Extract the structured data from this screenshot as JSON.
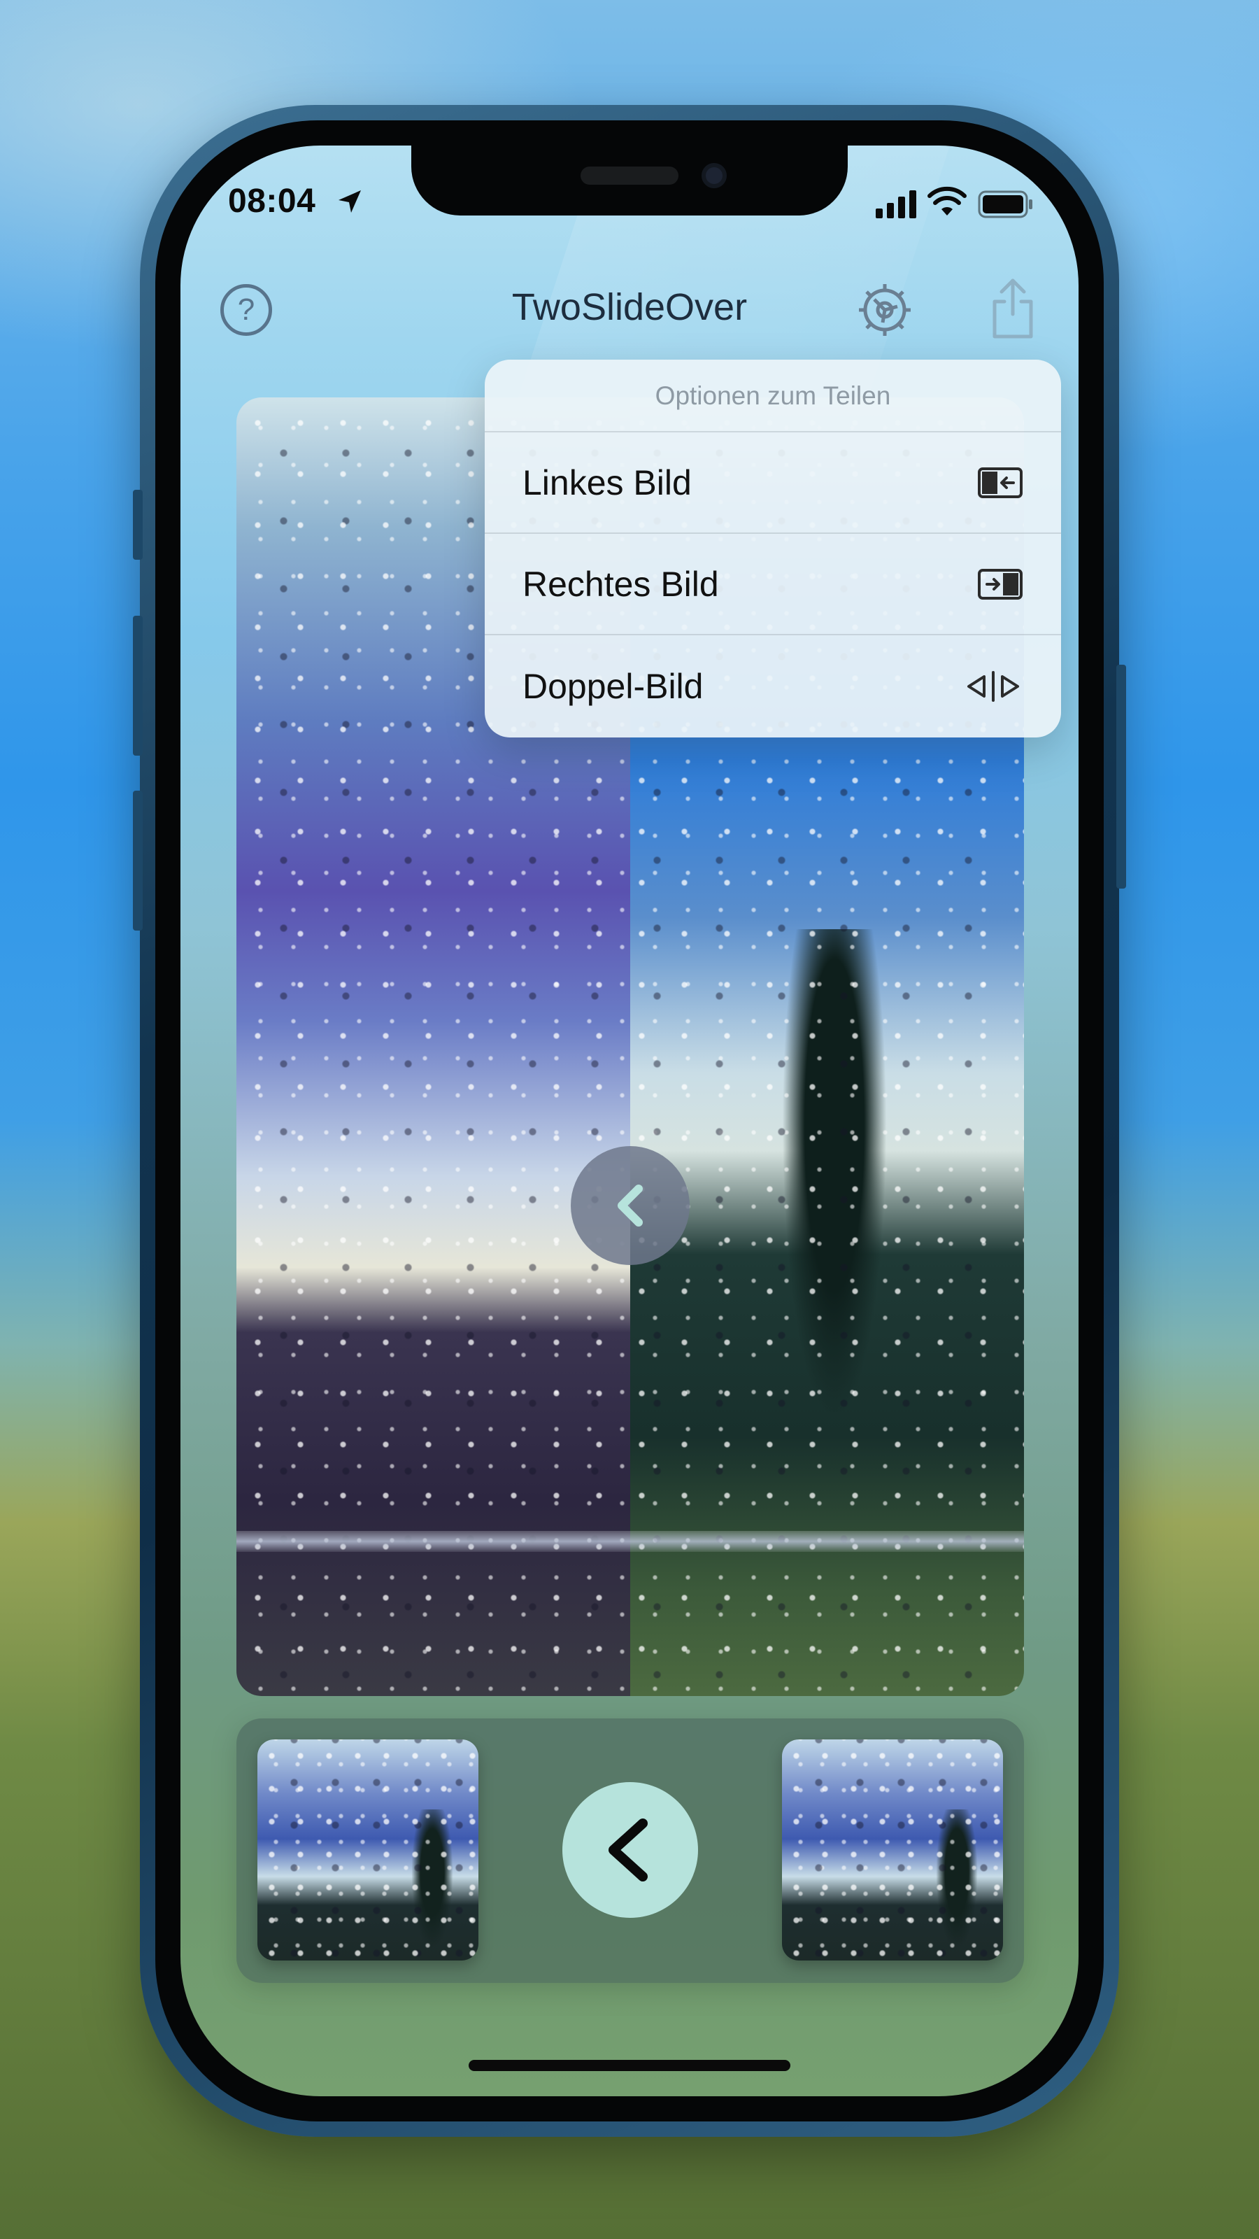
{
  "status_bar": {
    "time": "08:04",
    "icons": [
      "location-arrow-icon",
      "cellular-signal-icon",
      "wifi-icon",
      "battery-icon"
    ]
  },
  "nav": {
    "help_symbol": "?",
    "title": "TwoSlideOver",
    "icons": [
      "help-icon",
      "gear-icon",
      "share-icon"
    ]
  },
  "share_menu": {
    "header": "Optionen zum Teilen",
    "items": [
      {
        "label": "Linkes Bild",
        "icon": "left-image-icon"
      },
      {
        "label": "Rechtes Bild",
        "icon": "right-image-icon"
      },
      {
        "label": "Doppel-Bild",
        "icon": "double-image-icon"
      }
    ]
  },
  "colors": {
    "accent_button": "#b6e3dc",
    "title_text": "#1d2d3e",
    "help_icon": "#58748c"
  }
}
